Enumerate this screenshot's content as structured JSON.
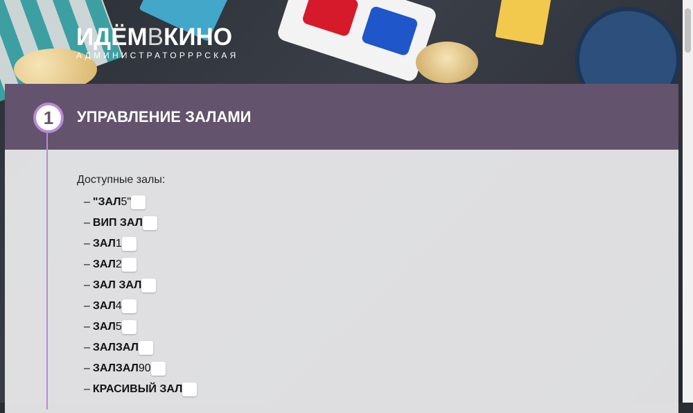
{
  "header": {
    "logo_part1": "ИДЁМ",
    "logo_part2": "В",
    "logo_part3": "КИНО",
    "subtitle": "АДМИНИСТРАТОРРРСКАЯ"
  },
  "section": {
    "step_number": "1",
    "title": "УПРАВЛЕНИЕ ЗАЛАМИ",
    "halls_label": "Доступные залы:",
    "dash": "–",
    "halls": [
      {
        "bold": "\"ЗАЛ",
        "normal": " 5\""
      },
      {
        "bold": "ВИП ЗАЛ",
        "normal": ""
      },
      {
        "bold": "ЗАЛ",
        "normal": " 1"
      },
      {
        "bold": "ЗАЛ",
        "normal": " 2"
      },
      {
        "bold": "ЗАЛ ЗАЛ",
        "normal": ""
      },
      {
        "bold": "ЗАЛ",
        "normal": "4"
      },
      {
        "bold": "ЗАЛ",
        "normal": "5"
      },
      {
        "bold": "ЗАЛЗАЛ",
        "normal": ""
      },
      {
        "bold": "ЗАЛЗАЛ",
        "normal": "90"
      },
      {
        "bold": "КРАСИВЫЙ ЗАЛ",
        "normal": ""
      }
    ]
  },
  "colors": {
    "section_header": "#63536c",
    "accent": "#b78bd6"
  }
}
